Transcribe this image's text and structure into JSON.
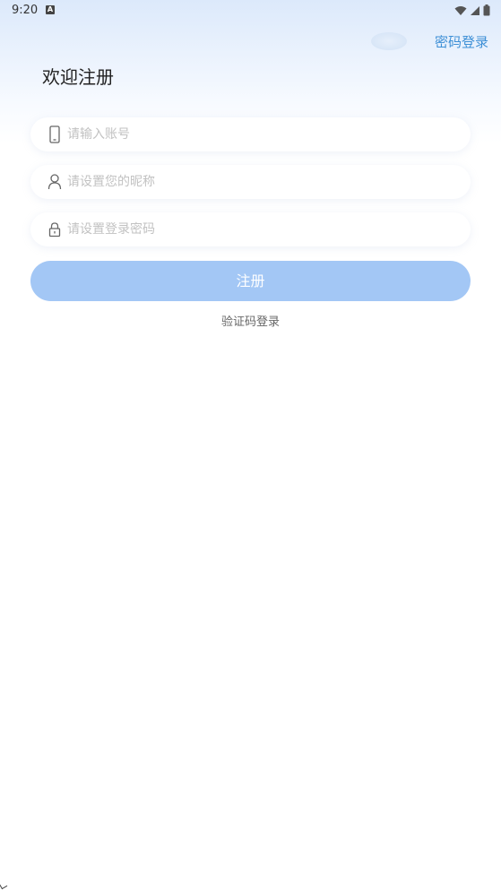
{
  "status_bar": {
    "time": "9:20",
    "notification_letter": "A"
  },
  "header": {
    "password_login_link": "密码登录",
    "title": "欢迎注册"
  },
  "form": {
    "account_placeholder": "请输入账号",
    "nickname_placeholder": "请设置您的昵称",
    "password_placeholder": "请设置登录密码",
    "register_button": "注册",
    "code_login_link": "验证码登录"
  },
  "colors": {
    "accent_link": "#3d8fd6",
    "button_bg": "#a3c7f5",
    "background_top": "#dce9fb"
  },
  "icons": {
    "account": "phone-icon",
    "nickname": "user-icon",
    "password": "lock-icon"
  }
}
